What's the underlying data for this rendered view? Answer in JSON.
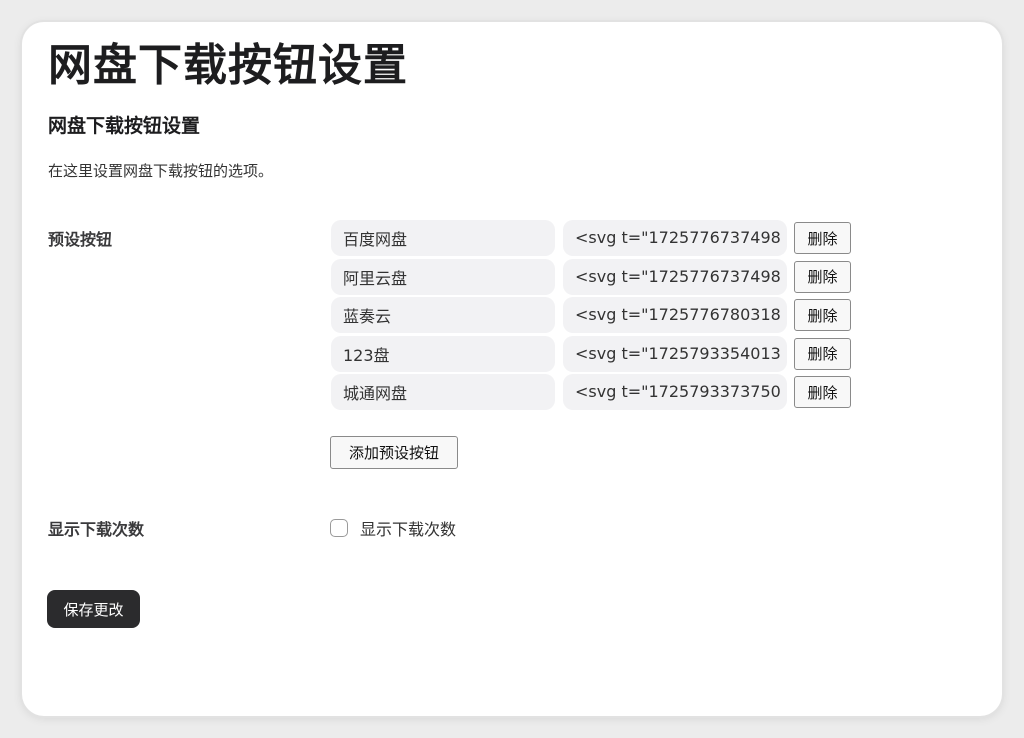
{
  "page": {
    "title": "网盘下载按钮设置",
    "section_title": "网盘下载按钮设置",
    "description": "在这里设置网盘下载按钮的选项。"
  },
  "presets": {
    "label": "预设按钮",
    "delete_label": "删除",
    "add_label": "添加预设按钮",
    "items": [
      {
        "name": "百度网盘",
        "svg": "<svg t=\"1725776737498"
      },
      {
        "name": "阿里云盘",
        "svg": "<svg t=\"1725776737498"
      },
      {
        "name": "蓝奏云",
        "svg": "<svg t=\"1725776780318"
      },
      {
        "name": "123盘",
        "svg": "<svg t=\"1725793354013"
      },
      {
        "name": "城通网盘",
        "svg": "<svg t=\"1725793373750"
      }
    ]
  },
  "download_count": {
    "label": "显示下载次数",
    "checkbox_label": "显示下载次数",
    "checked": false
  },
  "save_label": "保存更改"
}
